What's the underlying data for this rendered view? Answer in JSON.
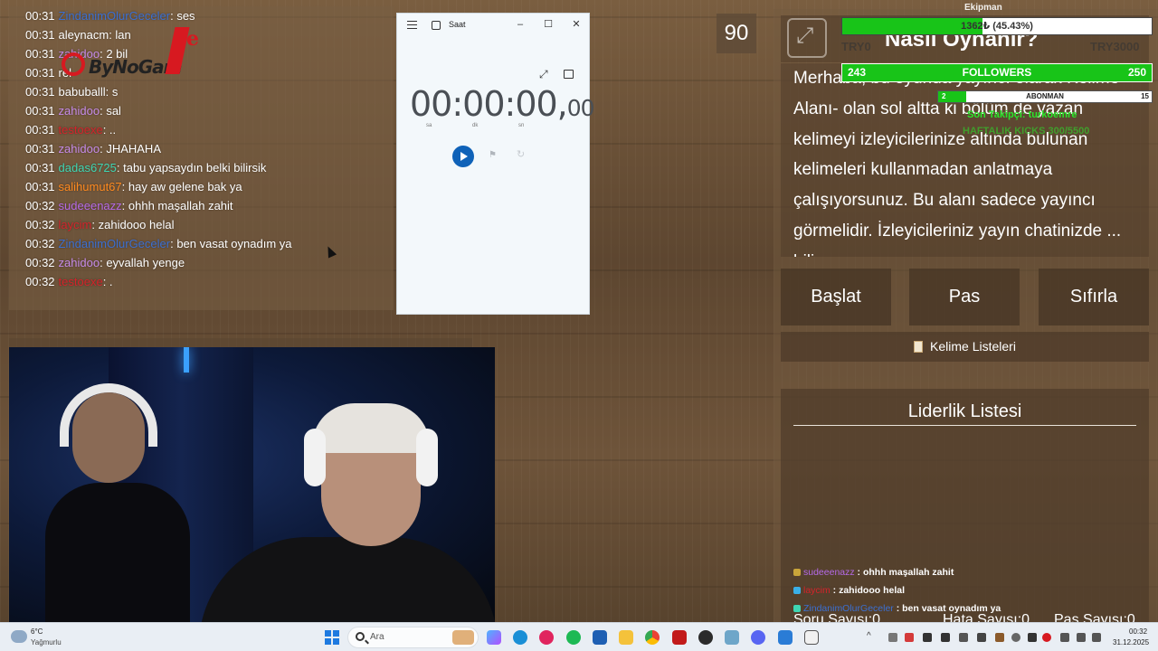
{
  "chat": {
    "lines": [
      {
        "time": "00:31",
        "user": "ZindanimOlurGeceler",
        "color": "#3b6fd1",
        "msg": ": ses"
      },
      {
        "time": "00:31",
        "user": "aleynacm",
        "color": "#ffffff",
        "msg": ": lan"
      },
      {
        "time": "00:31",
        "user": "zahidoo",
        "color": "#c68be8",
        "msg": ": 2 bil"
      },
      {
        "time": "00:31",
        "user": "",
        "color": "#ffffff",
        "msg": "rel"
      },
      {
        "time": "00:31",
        "user": "babuballl",
        "color": "#ffffff",
        "msg": ": s"
      },
      {
        "time": "00:31",
        "user": "zahidoo",
        "color": "#c68be8",
        "msg": ": sal"
      },
      {
        "time": "00:31",
        "user": "testoexe",
        "color": "#d4232b",
        "msg": ": .."
      },
      {
        "time": "00:31",
        "user": "zahidoo",
        "color": "#c68be8",
        "msg": ": JHAHAHA"
      },
      {
        "time": "00:31",
        "user": "dadas6725",
        "color": "#3fd6b3",
        "msg": ": tabu yapsaydın belki bilirsik"
      },
      {
        "time": "00:31",
        "user": "salihumut67",
        "color": "#ff8a1f",
        "msg": ": hay aw gelene bak ya"
      },
      {
        "time": "00:32",
        "user": "sudeeenazz",
        "color": "#b56ae8",
        "msg": ": ohhh maşallah zahit"
      },
      {
        "time": "00:32",
        "user": "laycim",
        "color": "#d4232b",
        "msg": ": zahidooo helal"
      },
      {
        "time": "00:32",
        "user": "ZindanimOlurGeceler",
        "color": "#3b6fd1",
        "msg": ": ben vasat oynadım ya"
      },
      {
        "time": "00:32",
        "user": "zahidoo",
        "color": "#c68be8",
        "msg": ": eyvallah yenge"
      },
      {
        "time": "00:32",
        "user": "testoexe",
        "color": "#d4232b",
        "msg": ": ."
      }
    ]
  },
  "logo": {
    "text": "ByNoGam",
    "suffix": "e",
    "brand_color": "#d71920"
  },
  "clock_app": {
    "title": "Saat",
    "minimize": "–",
    "maximize": "☐",
    "close": "✕",
    "timer_main": "00:00:00,",
    "timer_ms": "00",
    "unit_h": "sa",
    "unit_m": "dk",
    "unit_s": "sn",
    "accent": "#0f62b8"
  },
  "counter": {
    "value": "90"
  },
  "game": {
    "howto_title": "Nasıl Oynanır?",
    "howto_text": "Merhaba, bu oyunda yayıncı olarak Kelime Alanı- olan sol altta ki bölüm de yazan kelimeyi izleyicilerinize altında bulunan kelimeleri kullanmadan anlatmaya çalışıyorsunuz. Bu alanı sadece yayıncı görmelidir. İzleyicileriniz yayın chatinizde ... bili...",
    "btn_start": "Başlat",
    "btn_pass": "Pas",
    "btn_reset": "Sıfırla",
    "word_lists": "Kelime Listeleri",
    "leaderboard_title": "Liderlik Listesi",
    "stat_questions": "Soru Sayısı:0",
    "stat_errors": "Hata Sayısı:0",
    "stat_pass": "Pas Sayısı:0"
  },
  "overlay": {
    "goal_name": "Ekipman",
    "goal_pct_text": "1362₺ (45.43%)",
    "goal_progress": 0.4543,
    "try_left": "TRY0",
    "try_right": "TRY3000",
    "followers_current": "243",
    "followers_label": "FOLLOWERS",
    "followers_goal": "250",
    "sub_current": "2",
    "sub_label": "ABONMAN",
    "sub_goal": "15",
    "sub_progress": 0.13,
    "last_follower": "Son Takipçi: turkoemre",
    "kicks": "HAFTALIK KICKS 300/5500",
    "green": "#18c418"
  },
  "stream_chat": [
    {
      "user": "sudeeenazz",
      "color": "#b56ae8",
      "badge": "#c9a53a",
      "msg": " : ohhh maşallah zahit"
    },
    {
      "user": "laycim",
      "color": "#d4232b",
      "badge": "#3ab0e8",
      "msg": " : zahidooo helal"
    },
    {
      "user": "ZindanimOlurGeceler",
      "color": "#3b6fd1",
      "badge": "#3fd6b3",
      "msg": " : ben vasat oynadım ya"
    },
    {
      "user": "zahidoo",
      "color": "#c68be8",
      "badge": "#7bd46b",
      "msg": " : eyvallah yenge"
    },
    {
      "user": "testoexe",
      "color": "#d4232b",
      "badge": "#999999",
      "msg": " : ."
    }
  ],
  "taskbar": {
    "weather_temp": "6°C",
    "weather_desc": "Yağmurlu",
    "search_placeholder": "Ara",
    "time": "00:32",
    "date": "31.12.2025"
  }
}
